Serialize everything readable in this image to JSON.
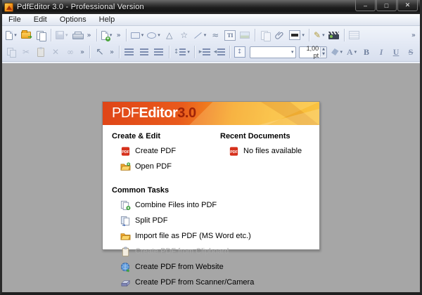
{
  "window": {
    "title": "PdfEditor 3.0 - Professional Version",
    "controls": {
      "minimize": "–",
      "maximize": "□",
      "close": "✕"
    }
  },
  "menubar": {
    "items": [
      {
        "label": "File"
      },
      {
        "label": "Edit"
      },
      {
        "label": "Options"
      },
      {
        "label": "Help"
      }
    ]
  },
  "icons": {
    "dropdown": "▾",
    "chevron": "»",
    "scissors": "✂",
    "delete": "✕",
    "link": "∞",
    "triangle": "△",
    "star": "☆",
    "freehand": "≈",
    "pencil": "✎",
    "green_arrow": "➜",
    "updown": "↕",
    "spin_up": "▲",
    "spin_down": "▼",
    "indent_right": "▸",
    "indent_left": "◂",
    "pointer": "↖"
  },
  "toolbar": {
    "text_tool_label": "TI",
    "font_size_value": "1,00 pt",
    "font_color_label": "A",
    "bold_label": "B",
    "italic_label": "I",
    "underline_label": "U",
    "strike_label": "S"
  },
  "panel": {
    "banner": {
      "brand_pdf": "PDF",
      "brand_editor": "Editor",
      "brand_version": "3.0"
    },
    "create_edit": {
      "title": "Create & Edit",
      "items": [
        {
          "label": "Create PDF"
        },
        {
          "label": "Open PDF"
        }
      ]
    },
    "recent": {
      "title": "Recent Documents",
      "items": [
        {
          "label": "No files available"
        }
      ]
    },
    "common_tasks": {
      "title": "Common Tasks",
      "items": [
        {
          "label": "Combine Files into PDF"
        },
        {
          "label": "Split PDF"
        },
        {
          "label": "Import file as PDF (MS Word etc.)"
        },
        {
          "label": "Create PDF from Clipboard"
        },
        {
          "label": "Create PDF from Website"
        },
        {
          "label": "Create PDF from Scanner/Camera"
        }
      ]
    }
  },
  "colors": {
    "banner_left": "#df4517",
    "banner_right": "#f9c342",
    "brand_version": "#9e2408",
    "workspace": "#a6a6a6",
    "toolbar_bg": "#e2e8f4",
    "titlebar": "#1d1d1d"
  }
}
